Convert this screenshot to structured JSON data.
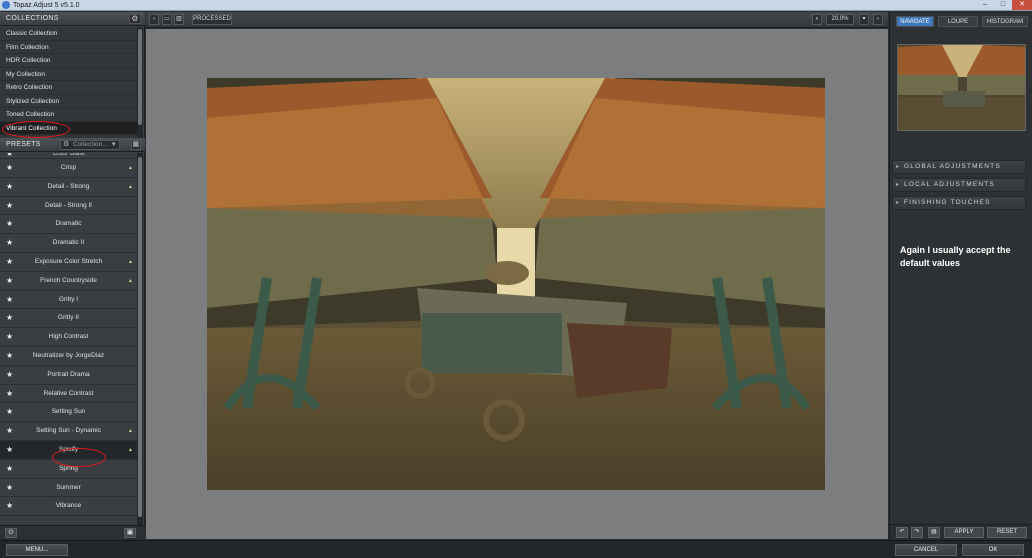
{
  "window": {
    "title": "Topaz Adjust 5 v5.1.0",
    "min": "–",
    "max": "□",
    "close": "✕"
  },
  "collections": {
    "header": "COLLECTIONS",
    "items": [
      {
        "label": "Classic Collection"
      },
      {
        "label": "Film Collection"
      },
      {
        "label": "HDR Collection"
      },
      {
        "label": "My Collection"
      },
      {
        "label": "Retro Collection"
      },
      {
        "label": "Stylized Collection"
      },
      {
        "label": "Toned Collection"
      },
      {
        "label": "Vibrant Collection",
        "active": true
      }
    ]
  },
  "presets": {
    "header": "PRESETS",
    "dropdown": "Collection...",
    "partial_label": "Color Blast",
    "items": [
      {
        "label": "Crisp",
        "mark": true
      },
      {
        "label": "Detail - Strong",
        "mark": true
      },
      {
        "label": "Detail - Strong II",
        "mark": false
      },
      {
        "label": "Dramatic",
        "mark": false
      },
      {
        "label": "Dramatic II",
        "mark": false
      },
      {
        "label": "Exposure Color Stretch",
        "mark": true
      },
      {
        "label": "French Countryside",
        "mark": true
      },
      {
        "label": "Gritty I",
        "mark": false
      },
      {
        "label": "Gritty II",
        "mark": false
      },
      {
        "label": "High Contrast",
        "mark": false
      },
      {
        "label": "Neutralizer by JorgeDiaz",
        "mark": false
      },
      {
        "label": "Portrait Drama",
        "mark": false
      },
      {
        "label": "Relative Contrast",
        "mark": false
      },
      {
        "label": "Setting Sun",
        "mark": false
      },
      {
        "label": "Setting Sun - Dynamic",
        "mark": true
      },
      {
        "label": "Spicify",
        "mark": true,
        "active": true
      },
      {
        "label": "Spring",
        "mark": false
      },
      {
        "label": "Summer",
        "mark": false
      },
      {
        "label": "Vibrance",
        "mark": false
      }
    ]
  },
  "toolbar": {
    "processed": "PROCESSED",
    "zoom": "20.0%"
  },
  "navigator": {
    "tabs": [
      {
        "label": "NAVIGATE",
        "active": true
      },
      {
        "label": "LOUPE",
        "active": false
      },
      {
        "label": "HISTOGRAM",
        "active": false
      }
    ]
  },
  "sections": [
    "GLOBAL ADJUSTMENTS",
    "LOCAL ADJUSTMENTS",
    "FINISHING TOUCHES"
  ],
  "note": "Again I usually accept the default values",
  "right_footer": {
    "apply": "APPLY",
    "reset": "RESET"
  },
  "bottom": {
    "menu": "MENU...",
    "cancel": "CANCEL",
    "ok": "OK"
  },
  "colors": {
    "accent": "#3f78b8",
    "annotation": "#e01a1a"
  }
}
